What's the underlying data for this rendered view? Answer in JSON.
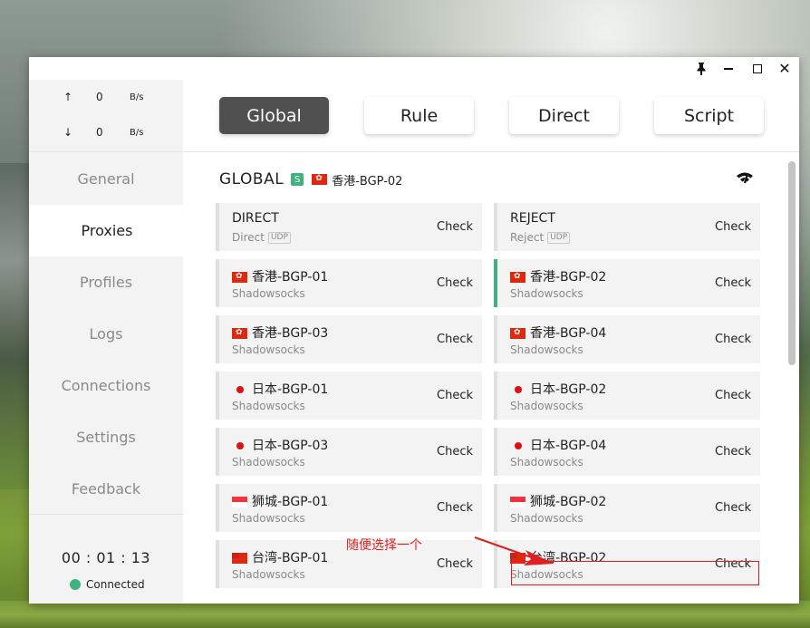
{
  "window": {
    "controls": {
      "pin": "pin-icon",
      "minimize": "minimize-icon",
      "maximize": "maximize-icon",
      "close": "close-icon"
    }
  },
  "traffic": {
    "up_arrow": "↑",
    "up_value": "0",
    "up_unit": "B/s",
    "down_arrow": "↓",
    "down_value": "0",
    "down_unit": "B/s"
  },
  "sidebar": {
    "items": [
      {
        "label": "General"
      },
      {
        "label": "Proxies"
      },
      {
        "label": "Profiles"
      },
      {
        "label": "Logs"
      },
      {
        "label": "Connections"
      },
      {
        "label": "Settings"
      },
      {
        "label": "Feedback"
      }
    ],
    "active": "Proxies",
    "timer": "00 : 01 : 13",
    "status": "Connected",
    "status_color": "#3fb37f"
  },
  "modes": {
    "items": [
      "Global",
      "Rule",
      "Direct",
      "Script"
    ],
    "active": "Global"
  },
  "group": {
    "name": "GLOBAL",
    "type_badge": "S",
    "selected": "香港-BGP-02",
    "selected_flag": "hk",
    "latency_icon": "wifi-signal-icon"
  },
  "proxies": [
    {
      "name": "DIRECT",
      "type": "Direct",
      "udp": "UDP",
      "flag": "",
      "check": "Check",
      "selected": false
    },
    {
      "name": "REJECT",
      "type": "Reject",
      "udp": "UDP",
      "flag": "",
      "check": "Check",
      "selected": false
    },
    {
      "name": "香港-BGP-01",
      "type": "Shadowsocks",
      "flag": "hk",
      "check": "Check",
      "selected": false
    },
    {
      "name": "香港-BGP-02",
      "type": "Shadowsocks",
      "flag": "hk",
      "check": "Check",
      "selected": true
    },
    {
      "name": "香港-BGP-03",
      "type": "Shadowsocks",
      "flag": "hk",
      "check": "Check",
      "selected": false
    },
    {
      "name": "香港-BGP-04",
      "type": "Shadowsocks",
      "flag": "hk",
      "check": "Check",
      "selected": false
    },
    {
      "name": "日本-BGP-01",
      "type": "Shadowsocks",
      "flag": "jp",
      "check": "Check",
      "selected": false
    },
    {
      "name": "日本-BGP-02",
      "type": "Shadowsocks",
      "flag": "jp",
      "check": "Check",
      "selected": false
    },
    {
      "name": "日本-BGP-03",
      "type": "Shadowsocks",
      "flag": "jp",
      "check": "Check",
      "selected": false
    },
    {
      "name": "日本-BGP-04",
      "type": "Shadowsocks",
      "flag": "jp",
      "check": "Check",
      "selected": false
    },
    {
      "name": "狮城-BGP-01",
      "type": "Shadowsocks",
      "flag": "sg",
      "check": "Check",
      "selected": false
    },
    {
      "name": "狮城-BGP-02",
      "type": "Shadowsocks",
      "flag": "sg",
      "check": "Check",
      "selected": false
    },
    {
      "name": "台湾-BGP-01",
      "type": "Shadowsocks",
      "flag": "tw",
      "check": "Check",
      "selected": false
    },
    {
      "name": "台湾-BGP-02",
      "type": "Shadowsocks",
      "flag": "tw",
      "check": "Check",
      "selected": false
    }
  ],
  "annotation": {
    "text": "随便选择一个",
    "color": "#e02020"
  }
}
